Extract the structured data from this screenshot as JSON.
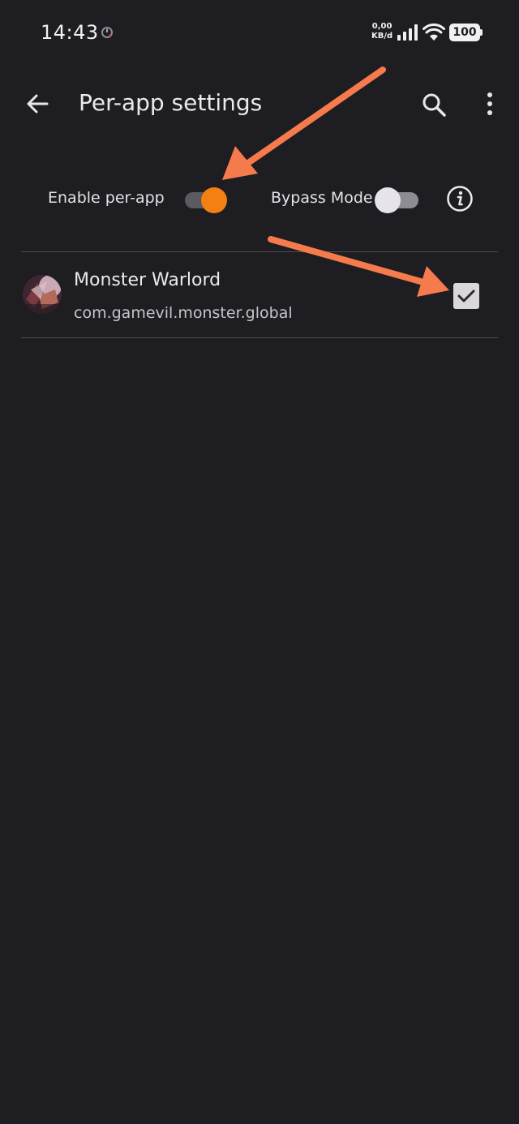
{
  "status_bar": {
    "time": "14:43",
    "net_speed_value": "0,00",
    "net_speed_unit": "KB/d",
    "battery": "100"
  },
  "app_bar": {
    "title": "Per-app settings"
  },
  "toggles": {
    "enable_label": "Enable per-app",
    "enable_on": true,
    "bypass_label": "Bypass Mode",
    "bypass_on": false
  },
  "apps": [
    {
      "name": "Monster Warlord",
      "package": "com.gamevil.monster.global",
      "checked": true
    }
  ],
  "colors": {
    "background": "#1e1d21",
    "accent": "#f47f12",
    "annotation_arrow": "#f57a4c"
  },
  "icons": [
    "back-arrow-icon",
    "search-icon",
    "more-vert-icon",
    "info-icon",
    "checkmark-icon",
    "wifi-icon",
    "signal-icon",
    "battery-icon"
  ]
}
